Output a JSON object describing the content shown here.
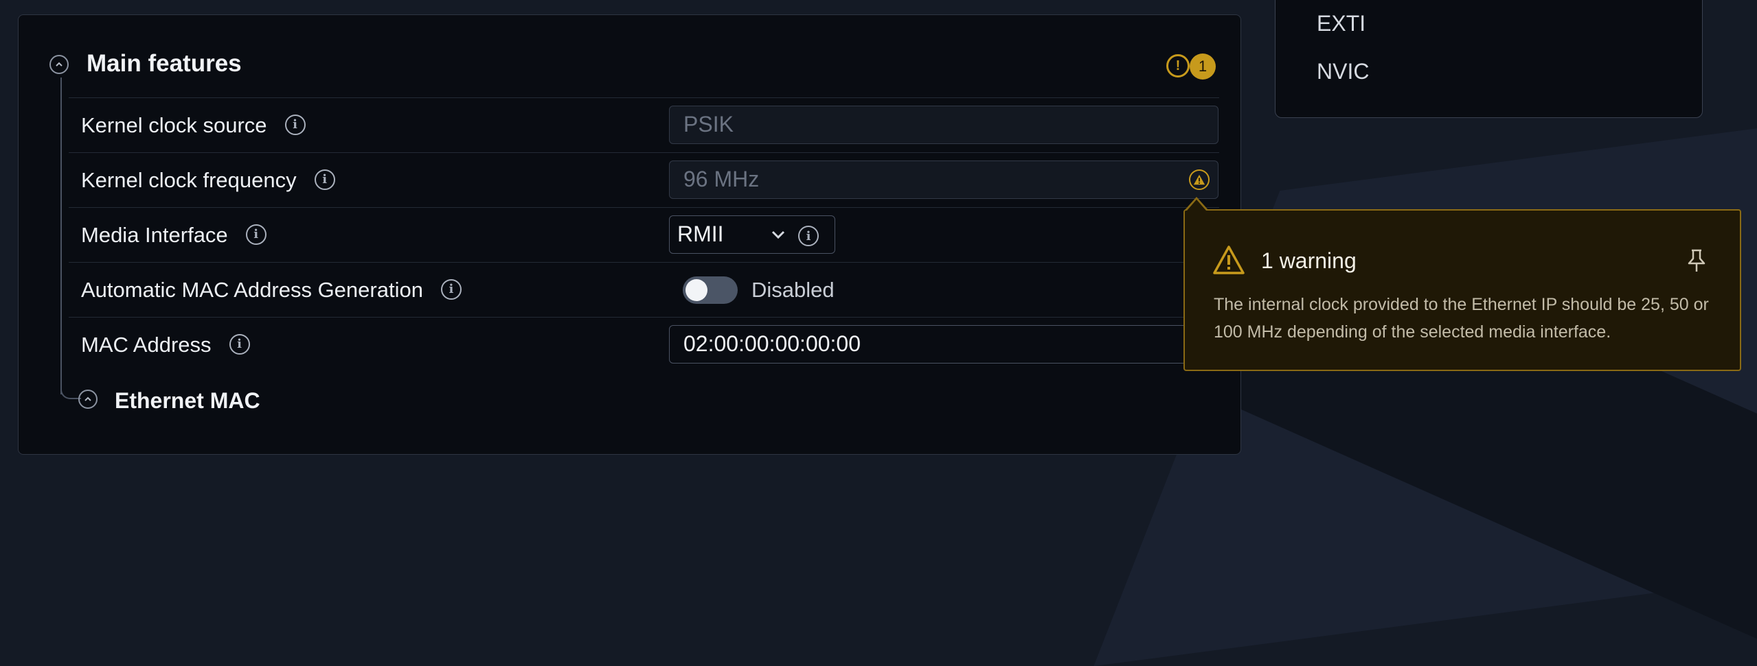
{
  "section": {
    "title": "Main features",
    "warning_count": "1",
    "warning_icon_glyph": "!"
  },
  "rows": [
    {
      "label": "Kernel clock source",
      "value": "PSIK"
    },
    {
      "label": "Kernel clock frequency",
      "value": "96 MHz"
    },
    {
      "label": "Media Interface",
      "value": "RMII"
    },
    {
      "label": "Automatic MAC Address Generation",
      "value": "Disabled"
    },
    {
      "label": "MAC Address",
      "value": "02:00:00:00:00:00"
    }
  ],
  "subsection": {
    "title": "Ethernet MAC"
  },
  "side_list": [
    "EXTI",
    "NVIC"
  ],
  "tooltip": {
    "title": "1 warning",
    "body": "The internal clock provided to the Ethernet IP should be 25, 50 or 100 MHz depending of the selected media interface."
  },
  "info_glyph": "i",
  "colors": {
    "accent_warning": "#c79a1c",
    "panel_bg": "#090c12",
    "page_bg": "#141a25",
    "tooltip_bg": "#1f1806"
  }
}
